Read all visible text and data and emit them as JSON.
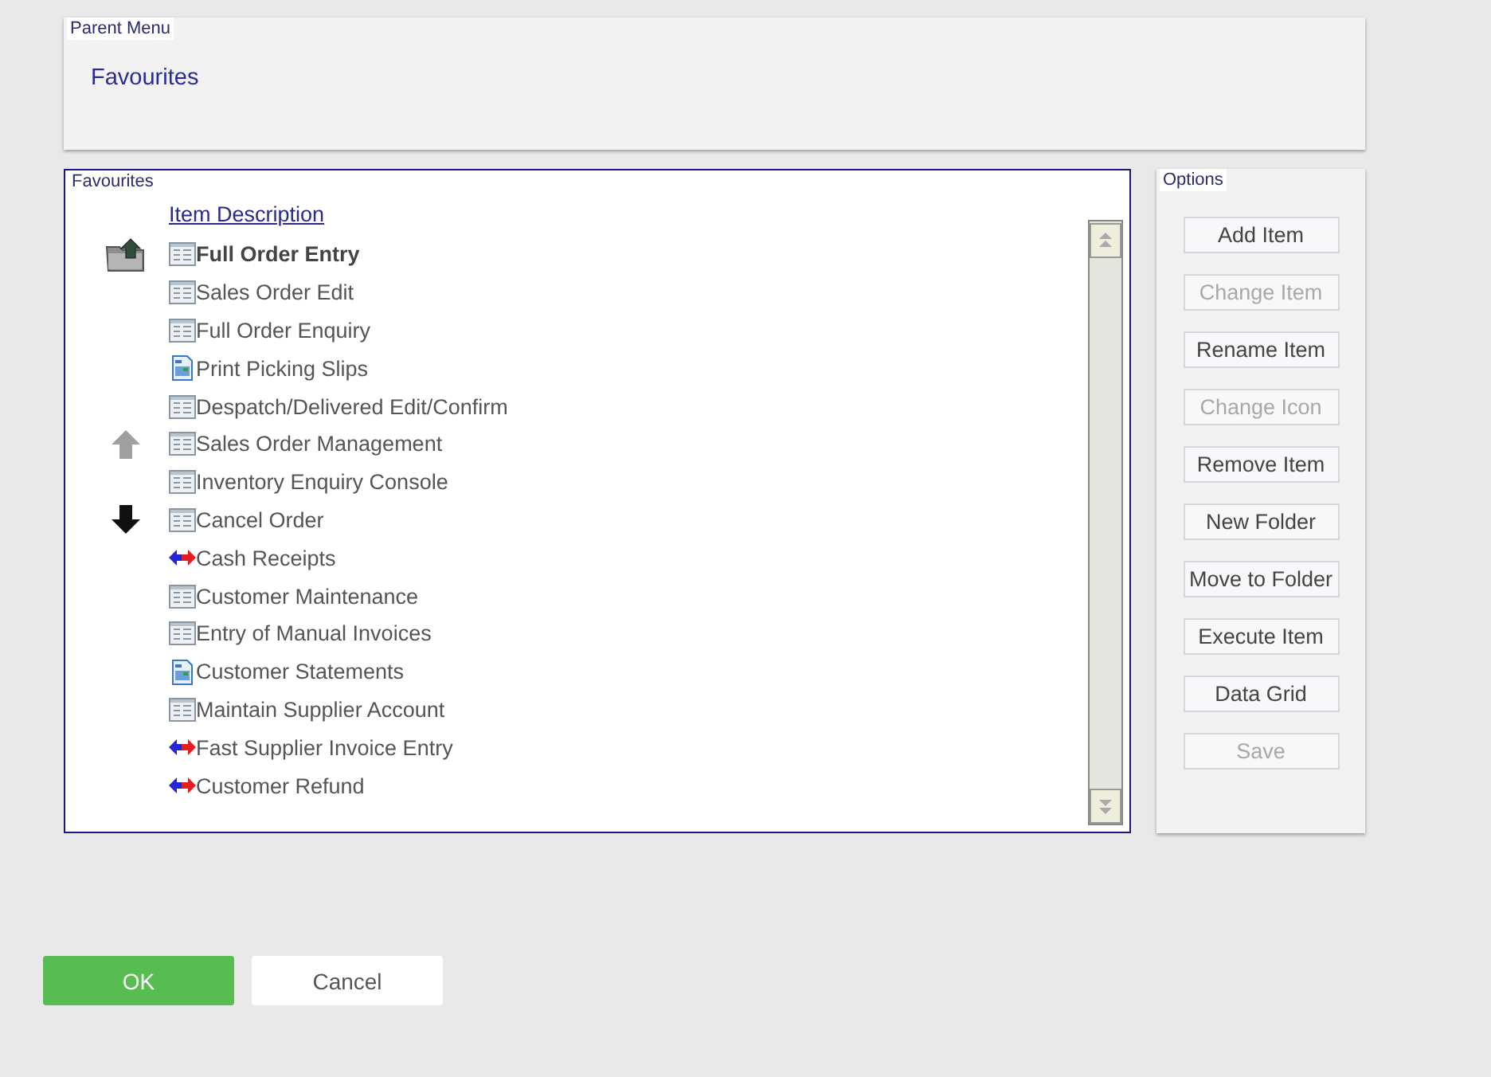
{
  "parent_menu": {
    "legend": "Parent Menu",
    "value": "Favourites"
  },
  "favourites": {
    "legend": "Favourites",
    "column": "Item Description",
    "items": [
      {
        "label": "Full Order Entry",
        "kind": "form",
        "selected": true,
        "tool": {
          "kind": "folder-up",
          "disabled": false
        }
      },
      {
        "label": "Sales Order Edit",
        "kind": "form",
        "selected": false
      },
      {
        "label": "Full Order Enquiry",
        "kind": "form",
        "selected": false
      },
      {
        "label": "Print Picking Slips",
        "kind": "report",
        "selected": false
      },
      {
        "label": "Despatch/Delivered Edit/Confirm",
        "kind": "form",
        "selected": false
      },
      {
        "label": "Sales Order Management",
        "kind": "form",
        "selected": false,
        "tool": {
          "kind": "move-up",
          "disabled": true
        }
      },
      {
        "label": "Inventory Enquiry Console",
        "kind": "form",
        "selected": false
      },
      {
        "label": "Cancel Order",
        "kind": "form",
        "selected": false,
        "tool": {
          "kind": "move-down",
          "disabled": false
        }
      },
      {
        "label": "Cash Receipts",
        "kind": "transfer",
        "selected": false
      },
      {
        "label": "Customer Maintenance",
        "kind": "form",
        "selected": false
      },
      {
        "label": "Entry of Manual Invoices",
        "kind": "form",
        "selected": false
      },
      {
        "label": "Customer Statements",
        "kind": "report",
        "selected": false
      },
      {
        "label": "Maintain Supplier Account",
        "kind": "form",
        "selected": false
      },
      {
        "label": "Fast Supplier Invoice Entry",
        "kind": "transfer",
        "selected": false
      },
      {
        "label": "Customer Refund",
        "kind": "transfer",
        "selected": false
      }
    ]
  },
  "options": {
    "legend": "Options",
    "buttons": [
      {
        "label": "Add Item",
        "disabled": false
      },
      {
        "label": "Change Item",
        "disabled": true
      },
      {
        "label": "Rename Item",
        "disabled": false
      },
      {
        "label": "Change Icon",
        "disabled": true
      },
      {
        "label": "Remove Item",
        "disabled": false
      },
      {
        "label": "New Folder",
        "disabled": false
      },
      {
        "label": "Move to Folder",
        "disabled": false
      },
      {
        "label": "Execute Item",
        "disabled": false
      },
      {
        "label": "Data Grid",
        "disabled": false
      },
      {
        "label": "Save",
        "disabled": true
      }
    ]
  },
  "footer": {
    "buttons": [
      {
        "label": "OK",
        "kind": "primary"
      },
      {
        "label": "Cancel",
        "kind": "secondary"
      }
    ]
  }
}
